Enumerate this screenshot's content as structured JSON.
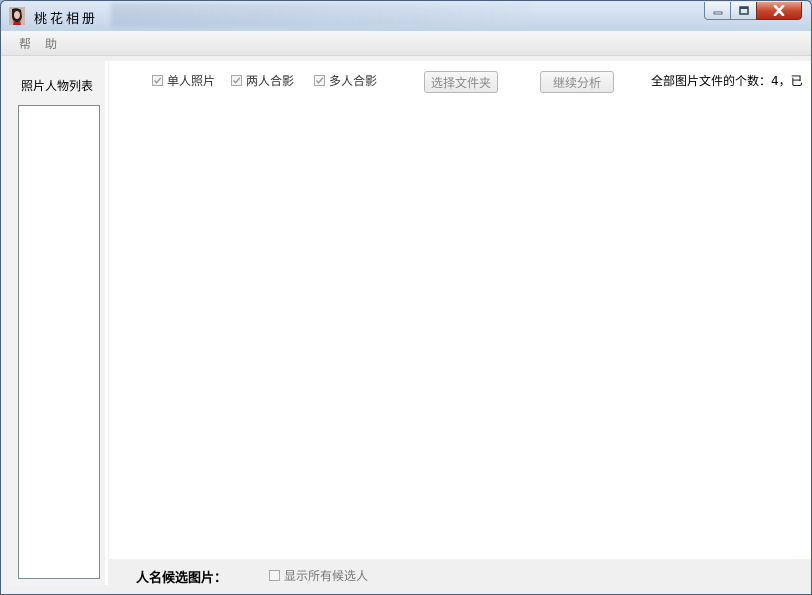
{
  "window": {
    "title": "桃花相册",
    "controls": {
      "minimize": "minimize",
      "maximize": "maximize",
      "close": "close"
    }
  },
  "menu": {
    "items": [
      {
        "label": "帮"
      },
      {
        "label": "助"
      }
    ]
  },
  "left_panel": {
    "title": "照片人物列表"
  },
  "toolbar": {
    "checkboxes": [
      {
        "label": "单人照片",
        "checked": true
      },
      {
        "label": "两人合影",
        "checked": true
      },
      {
        "label": "多人合影",
        "checked": true
      }
    ],
    "select_folder_label": "选择文件夹",
    "continue_label": "继续分析",
    "count_text": "全部图片文件的个数：4，已"
  },
  "bottom": {
    "candidate_label": "人名候选图片：",
    "show_all_label": "显示所有候选人",
    "show_all_checked": false
  }
}
